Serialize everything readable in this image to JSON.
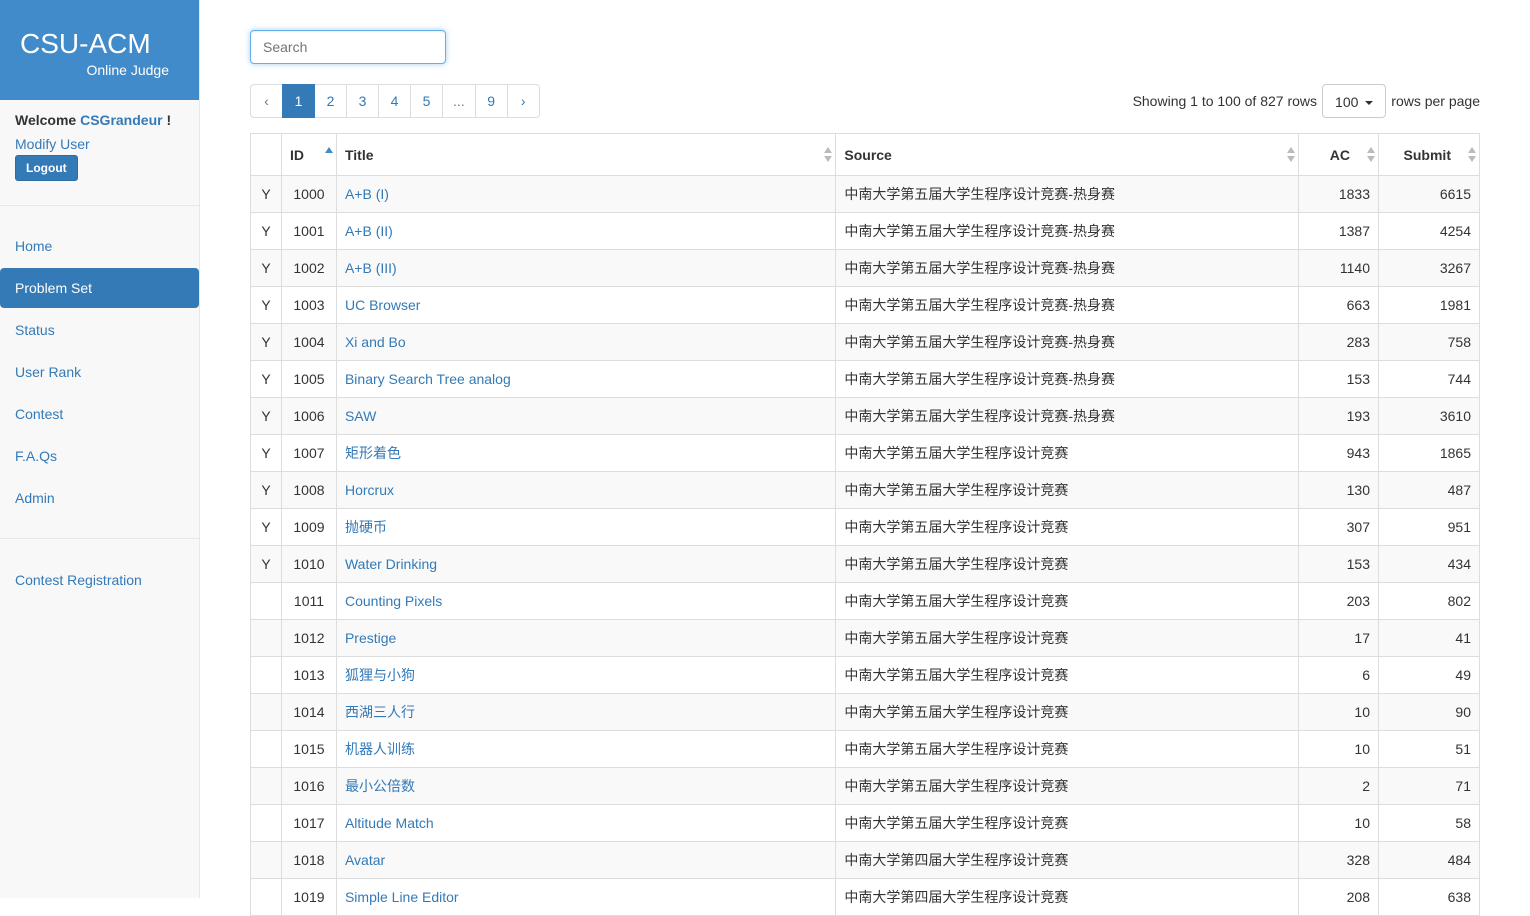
{
  "brand": {
    "name": "CSU-ACM",
    "sub": "Online Judge"
  },
  "user": {
    "welcome": "Welcome",
    "name": "CSGrandeur",
    "suffix": "!",
    "modify": "Modify User",
    "logout": "Logout"
  },
  "nav": [
    {
      "label": "Home",
      "active": false
    },
    {
      "label": "Problem Set",
      "active": true
    },
    {
      "label": "Status",
      "active": false
    },
    {
      "label": "User Rank",
      "active": false
    },
    {
      "label": "Contest",
      "active": false
    },
    {
      "label": "F.A.Qs",
      "active": false
    },
    {
      "label": "Admin",
      "active": false
    }
  ],
  "registration": "Contest Registration",
  "search": {
    "placeholder": "Search",
    "value": ""
  },
  "pagination": {
    "prev": "‹",
    "pages": [
      "1",
      "2",
      "3",
      "4",
      "5",
      "...",
      "9"
    ],
    "next": "›",
    "current": "1"
  },
  "pageinfo": {
    "showing": "Showing 1 to 100 of 827 rows",
    "size": "100",
    "suffix": "rows per page"
  },
  "table": {
    "columns": [
      "",
      "ID",
      "Title",
      "Source",
      "AC",
      "Submit"
    ],
    "rows": [
      [
        "Y",
        "1000",
        "A+B (I)",
        "中南大学第五届大学生程序设计竞赛-热身赛",
        "1833",
        "6615"
      ],
      [
        "Y",
        "1001",
        "A+B (II)",
        "中南大学第五届大学生程序设计竞赛-热身赛",
        "1387",
        "4254"
      ],
      [
        "Y",
        "1002",
        "A+B (III)",
        "中南大学第五届大学生程序设计竞赛-热身赛",
        "1140",
        "3267"
      ],
      [
        "Y",
        "1003",
        "UC Browser",
        "中南大学第五届大学生程序设计竞赛-热身赛",
        "663",
        "1981"
      ],
      [
        "Y",
        "1004",
        "Xi and Bo",
        "中南大学第五届大学生程序设计竞赛-热身赛",
        "283",
        "758"
      ],
      [
        "Y",
        "1005",
        "Binary Search Tree analog",
        "中南大学第五届大学生程序设计竞赛-热身赛",
        "153",
        "744"
      ],
      [
        "Y",
        "1006",
        "SAW",
        "中南大学第五届大学生程序设计竞赛-热身赛",
        "193",
        "3610"
      ],
      [
        "Y",
        "1007",
        "矩形着色",
        "中南大学第五届大学生程序设计竞赛",
        "943",
        "1865"
      ],
      [
        "Y",
        "1008",
        "Horcrux",
        "中南大学第五届大学生程序设计竞赛",
        "130",
        "487"
      ],
      [
        "Y",
        "1009",
        "抛硬币",
        "中南大学第五届大学生程序设计竞赛",
        "307",
        "951"
      ],
      [
        "Y",
        "1010",
        "Water Drinking",
        "中南大学第五届大学生程序设计竞赛",
        "153",
        "434"
      ],
      [
        "",
        "1011",
        "Counting Pixels",
        "中南大学第五届大学生程序设计竞赛",
        "203",
        "802"
      ],
      [
        "",
        "1012",
        "Prestige",
        "中南大学第五届大学生程序设计竞赛",
        "17",
        "41"
      ],
      [
        "",
        "1013",
        "狐狸与小狗",
        "中南大学第五届大学生程序设计竞赛",
        "6",
        "49"
      ],
      [
        "",
        "1014",
        "西湖三人行",
        "中南大学第五届大学生程序设计竞赛",
        "10",
        "90"
      ],
      [
        "",
        "1015",
        "机器人训练",
        "中南大学第五届大学生程序设计竞赛",
        "10",
        "51"
      ],
      [
        "",
        "1016",
        "最小公倍数",
        "中南大学第五届大学生程序设计竞赛",
        "2",
        "71"
      ],
      [
        "",
        "1017",
        "Altitude Match",
        "中南大学第五届大学生程序设计竞赛",
        "10",
        "58"
      ],
      [
        "",
        "1018",
        "Avatar",
        "中南大学第四届大学生程序设计竞赛",
        "328",
        "484"
      ],
      [
        "",
        "1019",
        "Simple Line Editor",
        "中南大学第四届大学生程序设计竞赛",
        "208",
        "638"
      ]
    ]
  },
  "colors": {
    "primary": "#337ab7",
    "brand_bg": "#428bca",
    "sidebar_bg": "#f8f8f8"
  }
}
